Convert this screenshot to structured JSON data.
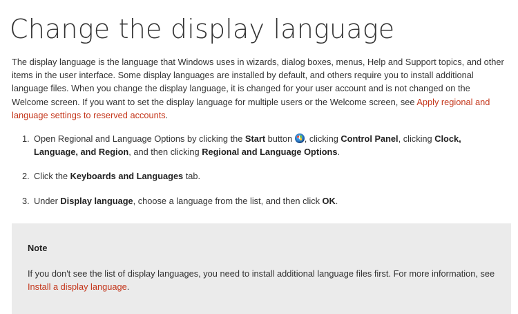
{
  "page": {
    "title": "Change the display language",
    "intro_text": "The display language is the language that Windows uses in wizards, dialog boxes, menus, Help and Support topics, and other items in the user interface. Some display languages are installed by default, and others require you to install additional language files. When you change the display language, it is changed for your user account and is not changed on the Welcome screen. If you want to set the display language for multiple users or the Welcome screen, see ",
    "intro_link": "Apply regional and language settings to reserved accounts",
    "intro_end": "."
  },
  "steps": [
    {
      "number": "1.",
      "t1": "Open Regional and Language Options by clicking the ",
      "b1": "Start",
      "t2": " button ",
      "icon": "windows-start-orb-icon",
      "t3": ", clicking ",
      "b2": "Control Panel",
      "t4": ", clicking ",
      "b3": "Clock, Language, and Region",
      "t5": ", and then clicking ",
      "b4": "Regional and Language Options",
      "t6": "."
    },
    {
      "number": "2.",
      "t1": "Click the ",
      "b1": "Keyboards and Languages",
      "t2": " tab."
    },
    {
      "number": "3.",
      "t1": "Under ",
      "b1": "Display language",
      "t2": ", choose a language from the list, and then click ",
      "b2": "OK",
      "t3": "."
    }
  ],
  "note": {
    "title": "Note",
    "text": "If you don't see the list of display languages, you need to install additional language files first. For more information, see ",
    "link": "Install a display language",
    "end": "."
  },
  "colors": {
    "link": "#c4361b",
    "note_background": "#ebebeb",
    "text": "#333333"
  }
}
